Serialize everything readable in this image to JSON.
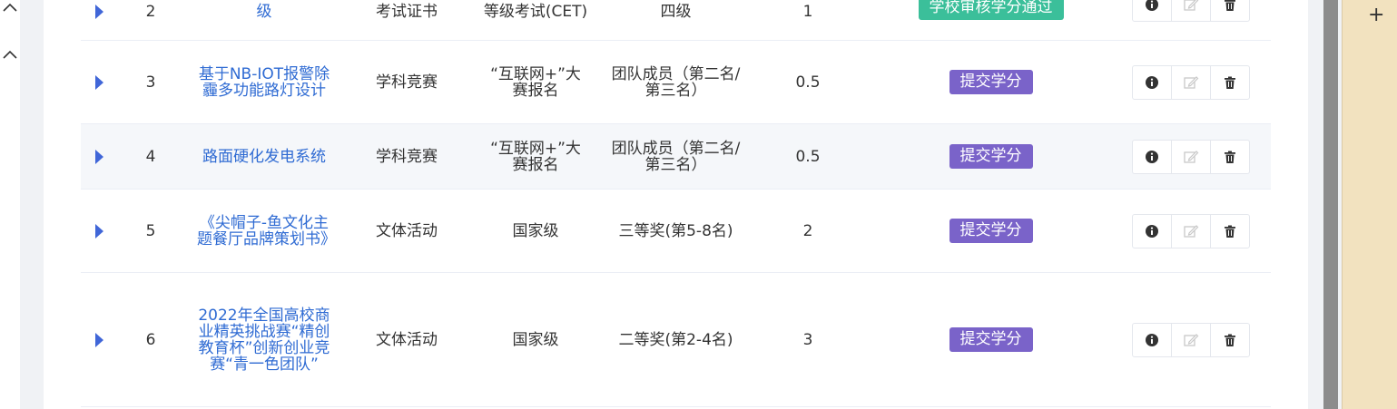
{
  "table": {
    "rows": [
      {
        "no": "2",
        "name": "级",
        "type": "考试证书",
        "level": "等级考试(CET)",
        "award": "四级",
        "credit": "1",
        "status": "学校审核学分通过",
        "status_color": "#3bbf9a"
      },
      {
        "no": "3",
        "name": "基于NB-IOT报警除霾多功能路灯设计",
        "type": "学科竞赛",
        "level": "“互联网+”大赛报名",
        "award": "团队成员（第二名/第三名）",
        "credit": "0.5",
        "status": "提交学分",
        "status_color": "#7a63c9"
      },
      {
        "no": "4",
        "name": "路面硬化发电系统",
        "type": "学科竞赛",
        "level": "“互联网+”大赛报名",
        "award": "团队成员（第二名/第三名）",
        "credit": "0.5",
        "status": "提交学分",
        "status_color": "#7a63c9"
      },
      {
        "no": "5",
        "name": "《尖帽子-鱼文化主题餐厅品牌策划书》",
        "type": "文体活动",
        "level": "国家级",
        "award": "三等奖(第5-8名)",
        "credit": "2",
        "status": "提交学分",
        "status_color": "#7a63c9"
      },
      {
        "no": "6",
        "name": "2022年全国高校商业精英挑战赛“精创 教育杯”创新创业竞赛“青一色团队”",
        "type": "文体活动",
        "level": "国家级",
        "award": "二等奖(第2-4名)",
        "credit": "3",
        "status": "提交学分",
        "status_color": "#7a63c9"
      }
    ],
    "ops": [
      "info-icon",
      "edit-icon",
      "delete-icon"
    ]
  },
  "colors": {
    "link": "#2f6bd3",
    "expand_arrow": "#4066d8",
    "right_pane": "#f2e2bf"
  }
}
